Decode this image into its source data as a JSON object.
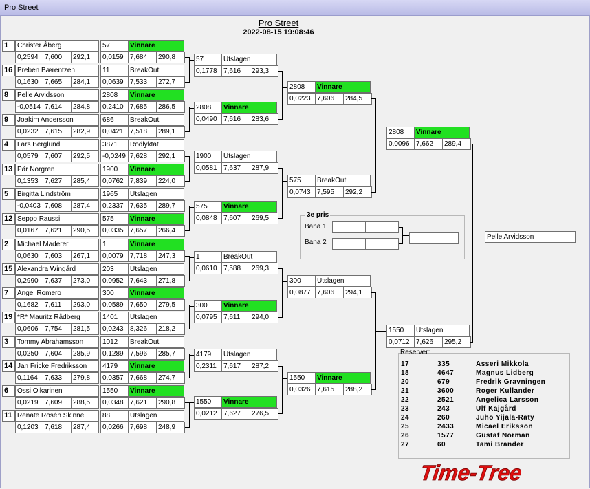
{
  "window_title": "Pro Street",
  "event_title": "Pro Street",
  "datetime": "2022-08-15 19:08:46",
  "round1": [
    {
      "seed": "1",
      "name": "Christer Åberg",
      "rt": "0,2594",
      "et": "7,600",
      "speed": "292,1"
    },
    {
      "seed": "16",
      "name": "Preben Bærentzen",
      "rt": "0,1630",
      "et": "7,665",
      "speed": "284,1"
    },
    {
      "seed": "8",
      "name": "Pelle Arvidsson",
      "rt": "-0,0514",
      "et": "7,614",
      "speed": "284,8"
    },
    {
      "seed": "9",
      "name": "Joakim Andersson",
      "rt": "0,0232",
      "et": "7,615",
      "speed": "282,9"
    },
    {
      "seed": "4",
      "name": "Lars Berglund",
      "rt": "0,0579",
      "et": "7,607",
      "speed": "292,5"
    },
    {
      "seed": "13",
      "name": "Pär  Norgren",
      "rt": "0,1353",
      "et": "7,627",
      "speed": "285,4"
    },
    {
      "seed": "5",
      "name": "Birgitta Lindström",
      "rt": "-0,0403",
      "et": "7,608",
      "speed": "287,4"
    },
    {
      "seed": "12",
      "name": "Seppo Raussi",
      "rt": "0,0167",
      "et": "7,621",
      "speed": "290,5"
    },
    {
      "seed": "2",
      "name": "Michael Maderer",
      "rt": "0,0630",
      "et": "7,603",
      "speed": "267,1"
    },
    {
      "seed": "15",
      "name": "Alexandra Wingård",
      "rt": "0,2990",
      "et": "7,637",
      "speed": "273,0"
    },
    {
      "seed": "7",
      "name": "Angel Romero",
      "rt": "0,1682",
      "et": "7,611",
      "speed": "293,0"
    },
    {
      "seed": "19",
      "name": "*R* Mauritz Rådberg",
      "rt": "0,0606",
      "et": "7,754",
      "speed": "281,5"
    },
    {
      "seed": "3",
      "name": "Tommy Abrahamsson",
      "rt": "0,0250",
      "et": "7,604",
      "speed": "285,9"
    },
    {
      "seed": "14",
      "name": "Jan Fricke Fredriksson",
      "rt": "0,1164",
      "et": "7,633",
      "speed": "279,8"
    },
    {
      "seed": "6",
      "name": "Ossi Oikarinen",
      "rt": "0,0219",
      "et": "7,609",
      "speed": "288,5"
    },
    {
      "seed": "11",
      "name": "Renate Rosén Skinne",
      "rt": "0,1203",
      "et": "7,618",
      "speed": "287,4"
    }
  ],
  "round2": [
    {
      "num": "57",
      "status": "Vinnare",
      "win": true,
      "rt": "0,0159",
      "et": "7,684",
      "speed": "290,8"
    },
    {
      "num": "11",
      "status": "BreakOut",
      "win": false,
      "rt": "0,0639",
      "et": "7,533",
      "speed": "272,7"
    },
    {
      "num": "2808",
      "status": "Vinnare",
      "win": true,
      "rt": "0,2410",
      "et": "7,685",
      "speed": "286,5"
    },
    {
      "num": "686",
      "status": "BreakOut",
      "win": false,
      "rt": "0,0421",
      "et": "7,518",
      "speed": "289,1"
    },
    {
      "num": "3871",
      "status": "Rödlyktat",
      "win": false,
      "rt": "-0,0249",
      "et": "7,628",
      "speed": "292,1"
    },
    {
      "num": "1900",
      "status": "Vinnare",
      "win": true,
      "rt": "0,0762",
      "et": "7,839",
      "speed": "224,0"
    },
    {
      "num": "1965",
      "status": "Utslagen",
      "win": false,
      "rt": "0,2337",
      "et": "7,635",
      "speed": "289,7"
    },
    {
      "num": "575",
      "status": "Vinnare",
      "win": true,
      "rt": "0,0335",
      "et": "7,657",
      "speed": "266,4"
    },
    {
      "num": "1",
      "status": "Vinnare",
      "win": true,
      "rt": "0,0079",
      "et": "7,718",
      "speed": "247,3"
    },
    {
      "num": "203",
      "status": "Utslagen",
      "win": false,
      "rt": "0,0952",
      "et": "7,643",
      "speed": "271,8"
    },
    {
      "num": "300",
      "status": "Vinnare",
      "win": true,
      "rt": "0,0589",
      "et": "7,650",
      "speed": "279,5"
    },
    {
      "num": "1401",
      "status": "Utslagen",
      "win": false,
      "rt": "0,0243",
      "et": "8,326",
      "speed": "218,2"
    },
    {
      "num": "1012",
      "status": "BreakOut",
      "win": false,
      "rt": "0,1289",
      "et": "7,596",
      "speed": "285,7"
    },
    {
      "num": "4179",
      "status": "Vinnare",
      "win": true,
      "rt": "0,0357",
      "et": "7,668",
      "speed": "274,7"
    },
    {
      "num": "1550",
      "status": "Vinnare",
      "win": true,
      "rt": "0,0348",
      "et": "7,621",
      "speed": "290,8"
    },
    {
      "num": "88",
      "status": "Utslagen",
      "win": false,
      "rt": "0,0266",
      "et": "7,698",
      "speed": "248,9"
    }
  ],
  "round3": [
    {
      "num": "57",
      "status": "Utslagen",
      "win": false,
      "rt": "0,1778",
      "et": "7,616",
      "speed": "293,3"
    },
    {
      "num": "2808",
      "status": "Vinnare",
      "win": true,
      "rt": "0,0490",
      "et": "7,616",
      "speed": "283,6"
    },
    {
      "num": "1900",
      "status": "Utslagen",
      "win": false,
      "rt": "0,0581",
      "et": "7,637",
      "speed": "287,9"
    },
    {
      "num": "575",
      "status": "Vinnare",
      "win": true,
      "rt": "0,0848",
      "et": "7,607",
      "speed": "269,5"
    },
    {
      "num": "1",
      "status": "BreakOut",
      "win": false,
      "rt": "0,0610",
      "et": "7,588",
      "speed": "269,3"
    },
    {
      "num": "300",
      "status": "Vinnare",
      "win": true,
      "rt": "0,0795",
      "et": "7,611",
      "speed": "294,0"
    },
    {
      "num": "4179",
      "status": "Utslagen",
      "win": false,
      "rt": "0,2311",
      "et": "7,617",
      "speed": "287,2"
    },
    {
      "num": "1550",
      "status": "Vinnare",
      "win": true,
      "rt": "0,0212",
      "et": "7,627",
      "speed": "276,5"
    }
  ],
  "round4": [
    {
      "num": "2808",
      "status": "Vinnare",
      "win": true,
      "rt": "0,0223",
      "et": "7,606",
      "speed": "284,5"
    },
    {
      "num": "575",
      "status": "BreakOut",
      "win": false,
      "rt": "0,0743",
      "et": "7,595",
      "speed": "292,2"
    },
    {
      "num": "300",
      "status": "Utslagen",
      "win": false,
      "rt": "0,0877",
      "et": "7,606",
      "speed": "294,1"
    },
    {
      "num": "1550",
      "status": "Vinnare",
      "win": true,
      "rt": "0,0326",
      "et": "7,615",
      "speed": "288,2"
    }
  ],
  "round5": [
    {
      "num": "2808",
      "status": "Vinnare",
      "win": true,
      "rt": "0,0096",
      "et": "7,662",
      "speed": "289,4"
    },
    {
      "num": "1550",
      "status": "Utslagen",
      "win": false,
      "rt": "0,0712",
      "et": "7,626",
      "speed": "295,2"
    }
  ],
  "winner": "Pelle Arvidsson",
  "third": {
    "title": "3e pris",
    "lane1": "Bana 1",
    "lane2": "Bana 2"
  },
  "reserves": {
    "title": "Reserver:",
    "rows": [
      {
        "seed": "17",
        "num": "335",
        "name": "Asseri Mikkola"
      },
      {
        "seed": "18",
        "num": "4647",
        "name": "Magnus Lidberg"
      },
      {
        "seed": "20",
        "num": "679",
        "name": "Fredrik Gravningen"
      },
      {
        "seed": "21",
        "num": "3600",
        "name": "Roger Kullander"
      },
      {
        "seed": "22",
        "num": "2521",
        "name": "Angelica Larsson"
      },
      {
        "seed": "23",
        "num": "243",
        "name": "Ulf Kajgård"
      },
      {
        "seed": "24",
        "num": "260",
        "name": "Juho Yijälä-Räty"
      },
      {
        "seed": "25",
        "num": "2433",
        "name": "Micael Eriksson"
      },
      {
        "seed": "26",
        "num": "1577",
        "name": "Gustaf Norman"
      },
      {
        "seed": "27",
        "num": "60",
        "name": "Tami Brander"
      }
    ]
  },
  "logo_text": "Time-Tree",
  "colors": {
    "winner": "#22e022",
    "logo": "#e01010"
  }
}
